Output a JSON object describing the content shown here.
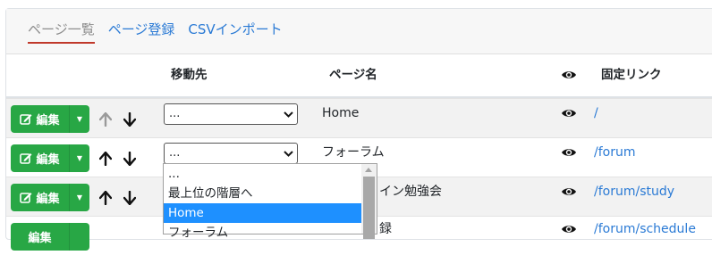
{
  "tabs": [
    {
      "label": "ページ一覧",
      "active": true
    },
    {
      "label": "ページ登録",
      "active": false
    },
    {
      "label": "CSVインポート",
      "active": false
    }
  ],
  "columns": {
    "move_to": "移動先",
    "page_name": "ページ名",
    "visibility_icon": "eye-icon",
    "permalink": "固定リンク"
  },
  "rows": [
    {
      "edit_label": "編集",
      "select_value": "...",
      "name": "Home",
      "link": "/",
      "show_up_arrow": false
    },
    {
      "edit_label": "編集",
      "select_value": "...",
      "name": "フォーラム",
      "link": "/forum",
      "show_up_arrow": true
    },
    {
      "edit_label": "編集",
      "select_value": "...",
      "name": "イン勉強会",
      "link": "/forum/study",
      "show_up_arrow": true
    },
    {
      "edit_label": "編集",
      "select_value": "...",
      "name": "録",
      "link": "/forum/schedule",
      "show_up_arrow": true
    }
  ],
  "dropdown": {
    "options": [
      "...",
      "最上位の階層へ",
      "Home",
      "フォーラム"
    ],
    "highlighted": "Home"
  },
  "colors": {
    "accent": "#2a7ad5",
    "success": "#28a745",
    "highlight": "#1e90ff",
    "active_underline": "#c0392b"
  }
}
